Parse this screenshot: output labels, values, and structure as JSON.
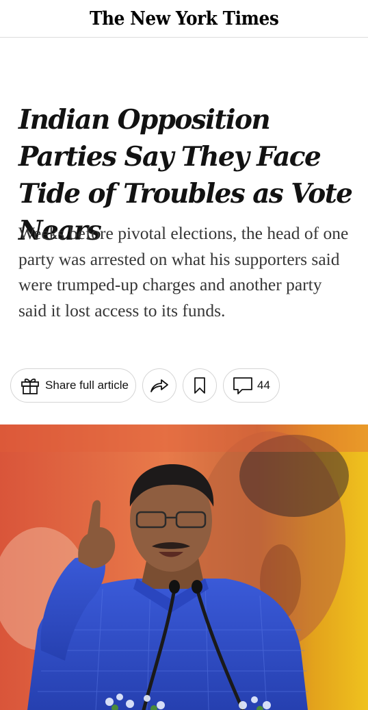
{
  "masthead": {
    "logo_text": "The New York Times"
  },
  "article": {
    "headline": "Indian Opposition Parties Say They Face Tide of Troubles as Vote Nears",
    "summary": "Weeks before pivotal elections, the head of one party was arrested on what his supporters said were trumped-up charges and another party said it lost access to its funds."
  },
  "actions": {
    "share_label": "Share full article",
    "comment_count": "44",
    "icons": [
      "gift-icon",
      "share-arrow-icon",
      "bookmark-icon",
      "comment-icon"
    ]
  },
  "hero_image": {
    "description_icon": "photo",
    "colors": {
      "background_left": "#e0603a",
      "background_right": "#e8b81a",
      "shirt": "#2f4fc8",
      "skin": "#8a5a3c"
    }
  }
}
